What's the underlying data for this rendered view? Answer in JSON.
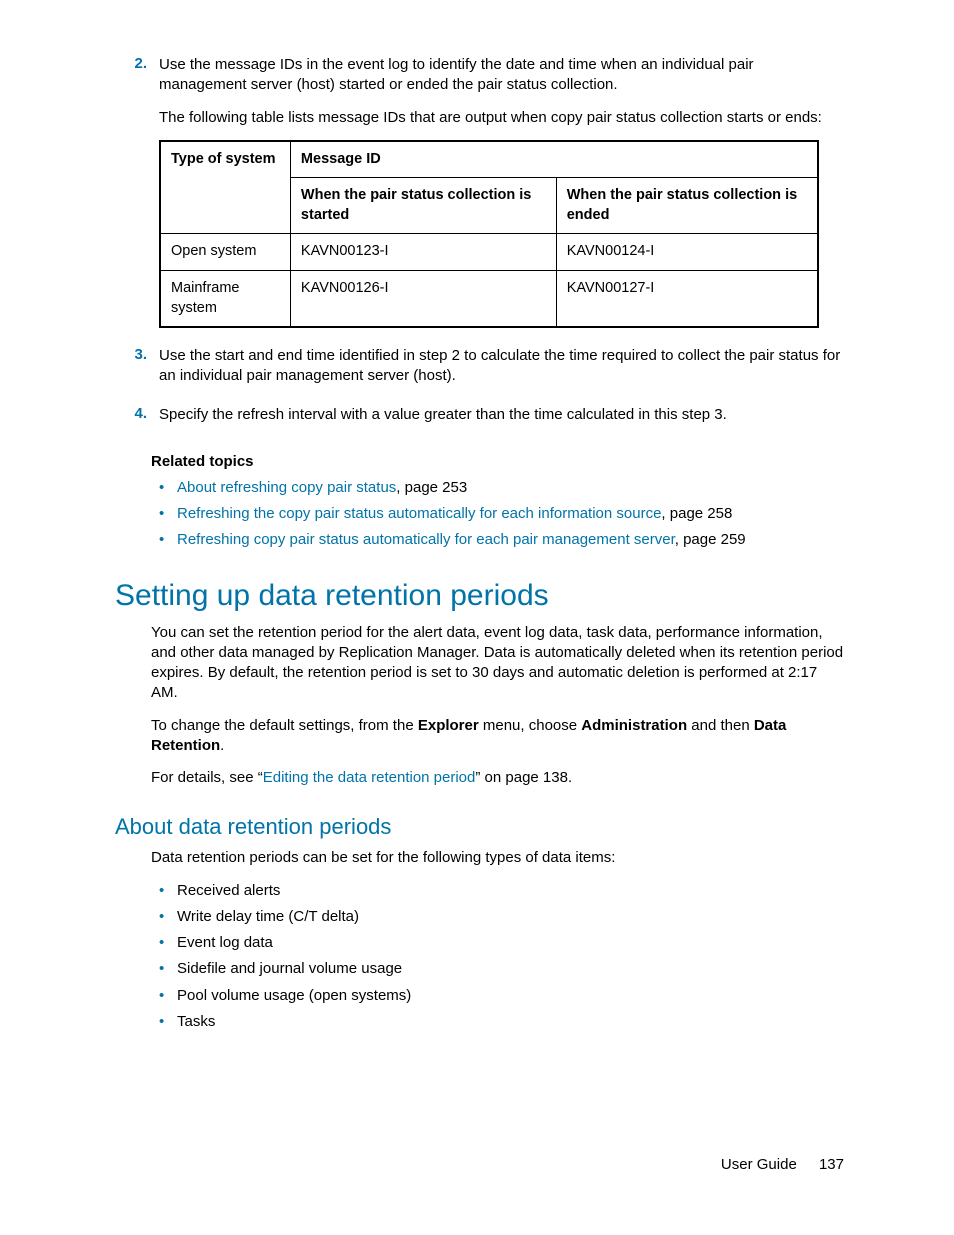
{
  "step2": {
    "num": "2.",
    "p1": "Use the message IDs in the event log to identify the date and time when an individual pair management server (host) started or ended the pair status collection.",
    "p2": "The following table lists message IDs that are output when copy pair status collection starts or ends:"
  },
  "table": {
    "h_type": "Type of system",
    "h_msgid": "Message ID",
    "h_started": "When the pair status collection is started",
    "h_ended": "When the pair status collec­tion is ended",
    "rows": [
      {
        "type": "Open system",
        "start": "KAVN00123-I",
        "end": "KAVN00124-I"
      },
      {
        "type": "Mainframe system",
        "start": "KAVN00126-I",
        "end": "KAVN00127-I"
      }
    ]
  },
  "step3": {
    "num": "3.",
    "text": "Use the start and end time identified in step 2 to calculate the time required to collect the pair status for an individual pair management server (host)."
  },
  "step4": {
    "num": "4.",
    "text": "Specify the refresh interval with a value  greater than the time calculated in this step 3."
  },
  "related": {
    "heading": "Related topics",
    "items": [
      {
        "link": "About refreshing copy pair status",
        "suffix": ", page 253"
      },
      {
        "link": "Refreshing the copy pair status automatically for each information source",
        "suffix": ", page 258"
      },
      {
        "link": "Refreshing copy pair status automatically for each pair management server",
        "suffix": ", page 259"
      }
    ]
  },
  "h1": "Setting up data retention periods",
  "intro": {
    "p1": "You can set the retention period for the alert data, event log data, task data, performance information, and other data managed by Replication Manager. Data is automatically deleted when its retention period expires. By default, the retention period is set to 30 days and automatic deletion is performed at 2:17 AM.",
    "p2_a": "To change the default settings, from the ",
    "p2_b": "Explorer",
    "p2_c": " menu, choose ",
    "p2_d": "Administration",
    "p2_e": " and then ",
    "p2_f": "Data Retention",
    "p2_g": ".",
    "p3_a": "For details, see “",
    "p3_link": "Editing the data retention period",
    "p3_b": "” on page 138."
  },
  "h2": "About data retention periods",
  "about_p": "Data retention periods can be set for the following types of data items:",
  "about_items": [
    "Received alerts",
    "Write delay time (C/T delta)",
    "Event log data",
    "Sidefile and journal volume usage",
    "Pool volume usage (open systems)",
    "Tasks"
  ],
  "footer": {
    "label": "User Guide",
    "page": "137"
  }
}
